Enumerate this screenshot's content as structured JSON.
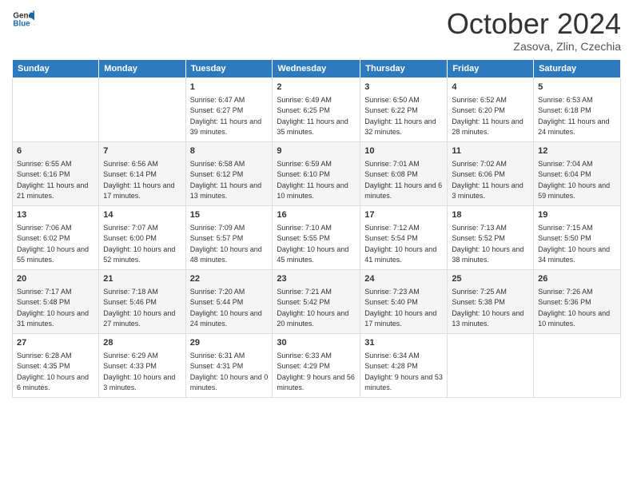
{
  "logo": {
    "line1": "General",
    "line2": "Blue"
  },
  "title": "October 2024",
  "location": "Zasova, Zlin, Czechia",
  "days_of_week": [
    "Sunday",
    "Monday",
    "Tuesday",
    "Wednesday",
    "Thursday",
    "Friday",
    "Saturday"
  ],
  "weeks": [
    [
      {
        "day": "",
        "info": ""
      },
      {
        "day": "",
        "info": ""
      },
      {
        "day": "1",
        "info": "Sunrise: 6:47 AM\nSunset: 6:27 PM\nDaylight: 11 hours and 39 minutes."
      },
      {
        "day": "2",
        "info": "Sunrise: 6:49 AM\nSunset: 6:25 PM\nDaylight: 11 hours and 35 minutes."
      },
      {
        "day": "3",
        "info": "Sunrise: 6:50 AM\nSunset: 6:22 PM\nDaylight: 11 hours and 32 minutes."
      },
      {
        "day": "4",
        "info": "Sunrise: 6:52 AM\nSunset: 6:20 PM\nDaylight: 11 hours and 28 minutes."
      },
      {
        "day": "5",
        "info": "Sunrise: 6:53 AM\nSunset: 6:18 PM\nDaylight: 11 hours and 24 minutes."
      }
    ],
    [
      {
        "day": "6",
        "info": "Sunrise: 6:55 AM\nSunset: 6:16 PM\nDaylight: 11 hours and 21 minutes."
      },
      {
        "day": "7",
        "info": "Sunrise: 6:56 AM\nSunset: 6:14 PM\nDaylight: 11 hours and 17 minutes."
      },
      {
        "day": "8",
        "info": "Sunrise: 6:58 AM\nSunset: 6:12 PM\nDaylight: 11 hours and 13 minutes."
      },
      {
        "day": "9",
        "info": "Sunrise: 6:59 AM\nSunset: 6:10 PM\nDaylight: 11 hours and 10 minutes."
      },
      {
        "day": "10",
        "info": "Sunrise: 7:01 AM\nSunset: 6:08 PM\nDaylight: 11 hours and 6 minutes."
      },
      {
        "day": "11",
        "info": "Sunrise: 7:02 AM\nSunset: 6:06 PM\nDaylight: 11 hours and 3 minutes."
      },
      {
        "day": "12",
        "info": "Sunrise: 7:04 AM\nSunset: 6:04 PM\nDaylight: 10 hours and 59 minutes."
      }
    ],
    [
      {
        "day": "13",
        "info": "Sunrise: 7:06 AM\nSunset: 6:02 PM\nDaylight: 10 hours and 55 minutes."
      },
      {
        "day": "14",
        "info": "Sunrise: 7:07 AM\nSunset: 6:00 PM\nDaylight: 10 hours and 52 minutes."
      },
      {
        "day": "15",
        "info": "Sunrise: 7:09 AM\nSunset: 5:57 PM\nDaylight: 10 hours and 48 minutes."
      },
      {
        "day": "16",
        "info": "Sunrise: 7:10 AM\nSunset: 5:55 PM\nDaylight: 10 hours and 45 minutes."
      },
      {
        "day": "17",
        "info": "Sunrise: 7:12 AM\nSunset: 5:54 PM\nDaylight: 10 hours and 41 minutes."
      },
      {
        "day": "18",
        "info": "Sunrise: 7:13 AM\nSunset: 5:52 PM\nDaylight: 10 hours and 38 minutes."
      },
      {
        "day": "19",
        "info": "Sunrise: 7:15 AM\nSunset: 5:50 PM\nDaylight: 10 hours and 34 minutes."
      }
    ],
    [
      {
        "day": "20",
        "info": "Sunrise: 7:17 AM\nSunset: 5:48 PM\nDaylight: 10 hours and 31 minutes."
      },
      {
        "day": "21",
        "info": "Sunrise: 7:18 AM\nSunset: 5:46 PM\nDaylight: 10 hours and 27 minutes."
      },
      {
        "day": "22",
        "info": "Sunrise: 7:20 AM\nSunset: 5:44 PM\nDaylight: 10 hours and 24 minutes."
      },
      {
        "day": "23",
        "info": "Sunrise: 7:21 AM\nSunset: 5:42 PM\nDaylight: 10 hours and 20 minutes."
      },
      {
        "day": "24",
        "info": "Sunrise: 7:23 AM\nSunset: 5:40 PM\nDaylight: 10 hours and 17 minutes."
      },
      {
        "day": "25",
        "info": "Sunrise: 7:25 AM\nSunset: 5:38 PM\nDaylight: 10 hours and 13 minutes."
      },
      {
        "day": "26",
        "info": "Sunrise: 7:26 AM\nSunset: 5:36 PM\nDaylight: 10 hours and 10 minutes."
      }
    ],
    [
      {
        "day": "27",
        "info": "Sunrise: 6:28 AM\nSunset: 4:35 PM\nDaylight: 10 hours and 6 minutes."
      },
      {
        "day": "28",
        "info": "Sunrise: 6:29 AM\nSunset: 4:33 PM\nDaylight: 10 hours and 3 minutes."
      },
      {
        "day": "29",
        "info": "Sunrise: 6:31 AM\nSunset: 4:31 PM\nDaylight: 10 hours and 0 minutes."
      },
      {
        "day": "30",
        "info": "Sunrise: 6:33 AM\nSunset: 4:29 PM\nDaylight: 9 hours and 56 minutes."
      },
      {
        "day": "31",
        "info": "Sunrise: 6:34 AM\nSunset: 4:28 PM\nDaylight: 9 hours and 53 minutes."
      },
      {
        "day": "",
        "info": ""
      },
      {
        "day": "",
        "info": ""
      }
    ]
  ]
}
